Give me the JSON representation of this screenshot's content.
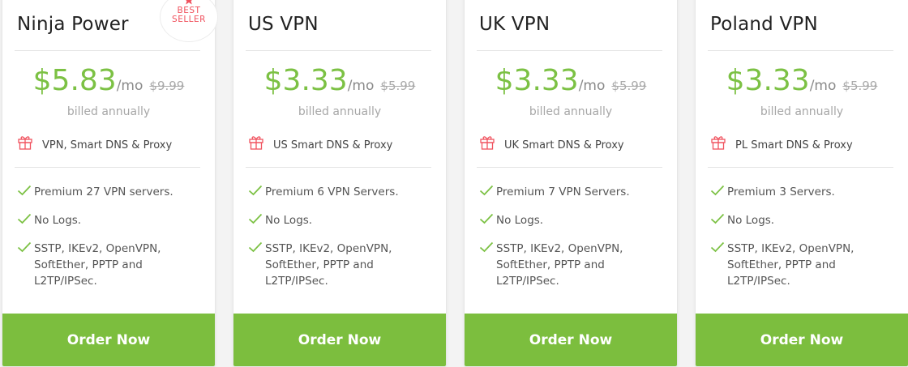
{
  "colors": {
    "price_green": "#7cc144",
    "button_green": "#7cbe3e",
    "gift_red": "#f0525e",
    "check_green": "#7cc144"
  },
  "icons": {
    "gift": "gift-icon",
    "check": "checkmark-icon",
    "star": "star-icon"
  },
  "badge": {
    "text": "BEST\nSELLER"
  },
  "plans": [
    {
      "title": "Ninja Power",
      "price": "$5.83",
      "per": "/mo",
      "old_price": "$9.99",
      "billed": "billed annually",
      "gift_text": "VPN, Smart DNS & Proxy",
      "features": [
        "Premium 27 VPN servers.",
        "No Logs.",
        "SSTP, IKEv2, OpenVPN, SoftEther, PPTP and L2TP/IPSec."
      ],
      "button": "Order Now"
    },
    {
      "title": "US VPN",
      "price": "$3.33",
      "per": "/mo",
      "old_price": "$5.99",
      "billed": "billed annually",
      "gift_text": "US Smart DNS & Proxy",
      "features": [
        "Premium 6 VPN Servers.",
        "No Logs.",
        "SSTP, IKEv2, OpenVPN, SoftEther, PPTP and L2TP/IPSec."
      ],
      "button": "Order Now"
    },
    {
      "title": "UK VPN",
      "price": "$3.33",
      "per": "/mo",
      "old_price": "$5.99",
      "billed": "billed annually",
      "gift_text": "UK Smart DNS & Proxy",
      "features": [
        "Premium 7 VPN Servers.",
        "No Logs.",
        "SSTP, IKEv2, OpenVPN, SoftEther, PPTP and L2TP/IPSec."
      ],
      "button": "Order Now"
    },
    {
      "title": "Poland VPN",
      "price": "$3.33",
      "per": "/mo",
      "old_price": "$5.99",
      "billed": "billed annually",
      "gift_text": "PL Smart DNS & Proxy",
      "features": [
        "Premium 3 Servers.",
        "No Logs.",
        "SSTP, IKEv2, OpenVPN, SoftEther, PPTP and L2TP/IPSec."
      ],
      "button": "Order Now"
    }
  ]
}
